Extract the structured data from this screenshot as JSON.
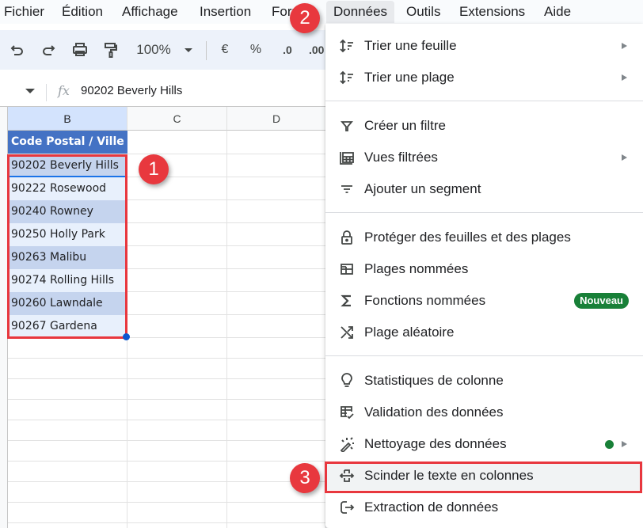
{
  "menubar": {
    "items": [
      "Fichier",
      "Édition",
      "Affichage",
      "Insertion",
      "Format",
      "Données",
      "Outils",
      "Extensions",
      "Aide"
    ],
    "active": "Données"
  },
  "toolbar": {
    "zoom": "100%",
    "currency": "€",
    "percent": "%",
    "decrease_decimals": ".0",
    "increase_decimals": ".00"
  },
  "formula_bar": {
    "fx": "fx",
    "value": "90202 Beverly Hills"
  },
  "grid": {
    "columns": [
      "B",
      "C",
      "D"
    ],
    "header": "Code Postal / Ville",
    "rows": [
      "90202 Beverly Hills",
      "90222 Rosewood",
      "90240 Rowney",
      "90250 Holly Park",
      "90263 Malibu",
      "90274 Rolling Hills",
      "90260 Lawndale",
      "90267 Gardena"
    ]
  },
  "badges": {
    "one": "1",
    "two": "2",
    "three": "3"
  },
  "dropdown": {
    "items": [
      {
        "label": "Trier une feuille",
        "icon": "sort-icon",
        "submenu": true
      },
      {
        "label": "Trier une plage",
        "icon": "sort-icon",
        "submenu": true
      },
      {
        "label": "Créer un filtre",
        "icon": "filter-icon"
      },
      {
        "label": "Vues filtrées",
        "icon": "filter-views-icon",
        "submenu": true
      },
      {
        "label": "Ajouter un segment",
        "icon": "slicer-icon"
      },
      {
        "label": "Protéger des feuilles et des plages",
        "icon": "lock-icon"
      },
      {
        "label": "Plages nommées",
        "icon": "named-ranges-icon"
      },
      {
        "label": "Fonctions nommées",
        "icon": "sigma-icon",
        "badge": "Nouveau"
      },
      {
        "label": "Plage aléatoire",
        "icon": "shuffle-icon"
      },
      {
        "label": "Statistiques de colonne",
        "icon": "lightbulb-icon"
      },
      {
        "label": "Validation des données",
        "icon": "data-validation-icon"
      },
      {
        "label": "Nettoyage des données",
        "icon": "magic-wand-icon",
        "submenu": true,
        "dot": true
      },
      {
        "label": "Scinder le texte en colonnes",
        "icon": "split-columns-icon",
        "highlighted": true
      },
      {
        "label": "Extraction de données",
        "icon": "extract-icon"
      }
    ]
  },
  "colors": {
    "annotation_red": "#e8383e",
    "header_blue": "#4472c4",
    "new_badge_green": "#188038"
  }
}
